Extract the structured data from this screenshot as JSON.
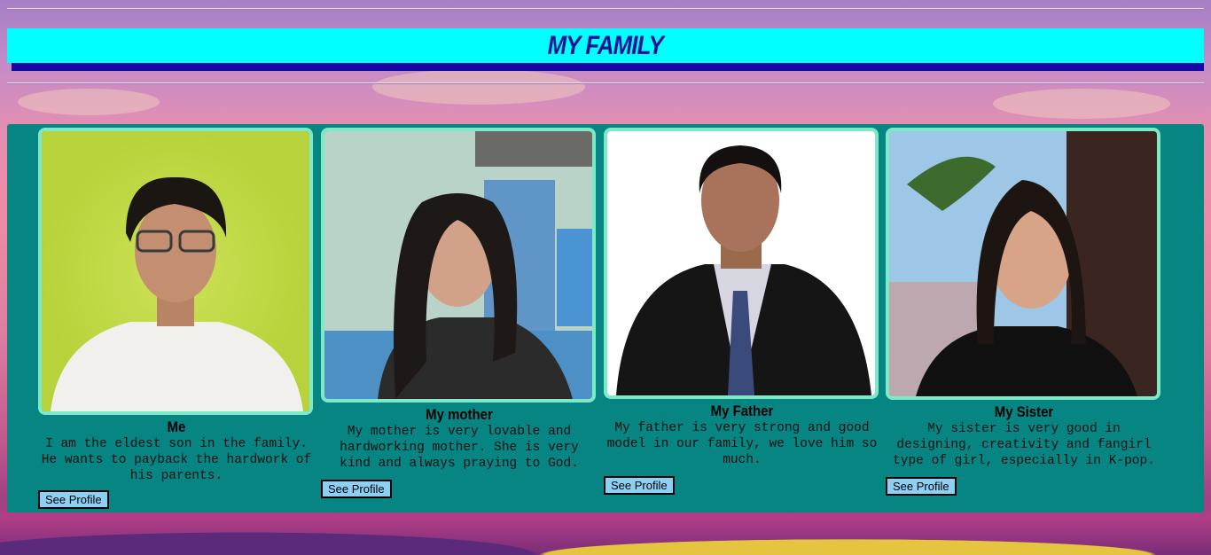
{
  "header": {
    "title": "MY FAMILY"
  },
  "members": [
    {
      "name": "Me",
      "description": "I am the eldest son in the family. He wants to payback the hardwork of his parents.",
      "button_label": "See Profile"
    },
    {
      "name": "My mother",
      "description": "My mother is very lovable and hardworking mother. She is very kind and always praying to God.",
      "button_label": "See Profile"
    },
    {
      "name": "My Father",
      "description": "My father is very strong and good model in our family, we love him so much.",
      "button_label": "See Profile"
    },
    {
      "name": "My Sister",
      "description": "My sister is very good in designing, creativity and fangirl type of girl, especially in K-pop.",
      "button_label": "See Profile"
    }
  ],
  "colors": {
    "banner": "#00ffff",
    "banner_shadow": "#1606a6",
    "panel": "#078582",
    "photo_border": "#7de9c6",
    "button": "#8ed0f4"
  }
}
